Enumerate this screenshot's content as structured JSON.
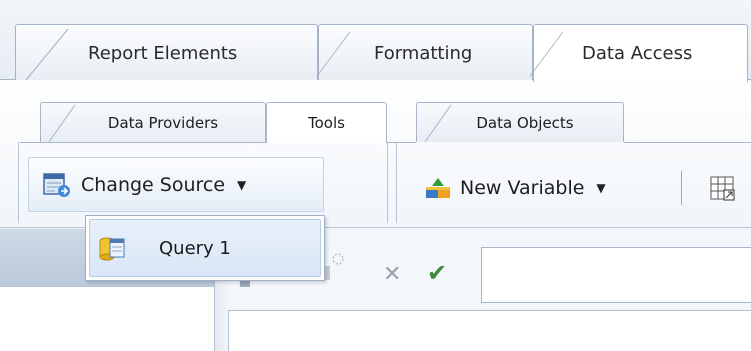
{
  "top_tabs": [
    {
      "label": "Report Elements"
    },
    {
      "label": "Formatting"
    },
    {
      "label": "Data Access"
    }
  ],
  "sub_tabs": [
    {
      "label": "Data Providers"
    },
    {
      "label": "Tools"
    },
    {
      "label": "Data Objects"
    }
  ],
  "ribbon": {
    "change_source_label": "Change Source",
    "new_variable_label": "New Variable"
  },
  "dropdown": {
    "items": [
      {
        "label": "Query 1"
      }
    ]
  },
  "icons": {
    "change_source": "change-source-icon",
    "new_variable": "new-variable-icon",
    "query": "database-query-icon",
    "cancel": "close-icon",
    "validate": "checkmark-icon",
    "table": "table-icon"
  }
}
